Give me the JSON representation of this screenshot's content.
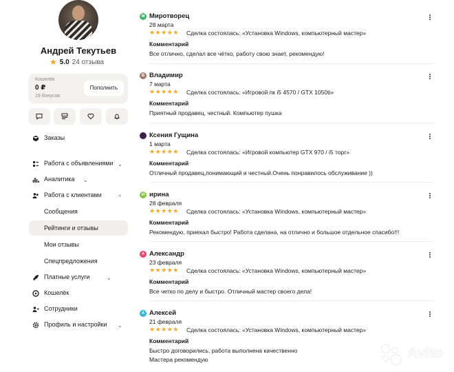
{
  "profile": {
    "name": "Андрей Текутьев",
    "rating": "5.0",
    "reviews_count": "24 отзыва"
  },
  "wallet": {
    "label": "Кошелёк",
    "balance": "0 ₽",
    "bonus": "19 бонусов",
    "topup_label": "Пополнить"
  },
  "quick_actions": [
    {
      "icon": "chat-icon"
    },
    {
      "icon": "list-icon"
    },
    {
      "icon": "heart-icon"
    },
    {
      "icon": "bell-icon"
    }
  ],
  "nav": {
    "orders": "Заказы",
    "ads": "Работа с объявлениями",
    "analytics": "Аналитика",
    "clients": "Работа с клиентами",
    "messages": "Сообщения",
    "ratings": "Рейтинги и отзывы",
    "my_reviews": "Мои отзывы",
    "special": "Спецпредложения",
    "paid": "Платные услуги",
    "wallet": "Кошелёк",
    "staff": "Сотрудники",
    "settings": "Профиль и настройки"
  },
  "reviews": [
    {
      "initial": "М",
      "avatar_color": "#3fb36b",
      "name": "Миротворец",
      "date": "28 марта",
      "stars": 5,
      "deal": "Сделка состоялась: «Установка Windows, компьютерный мастер»",
      "comment_label": "Комментарий",
      "comment": "Все отлично, сделал все чётко, работу свою знает, рекомендую!"
    },
    {
      "initial": "В",
      "avatar_color": "#9a7b6a",
      "name": "Владимир",
      "date": "7 марта",
      "stars": 5,
      "deal": "Сделка состоялась: «Игровой пк i5 4570 / GTX 1050ti»",
      "comment_label": "Комментарий",
      "comment": "Приятный продавец, честный. Компьютер пушка"
    },
    {
      "initial": "",
      "avatar_color": "#3a1f4a",
      "name": "Ксения Гущина",
      "date": "1 марта",
      "stars": 5,
      "deal": "Сделка состоялась: «Игровой компьютер GTX 970 / i5 торг»",
      "comment_label": "Комментарий",
      "comment": "Отличный продавец,понимающий и честный.Очень понравилось обслуживание ))"
    },
    {
      "initial": "И",
      "avatar_color": "#8bc34a",
      "name": "ирина",
      "date": "28 февраля",
      "stars": 5,
      "deal": "Сделка состоялась: «Установка Windows, компьютерный мастер»",
      "comment_label": "Комментарий",
      "comment": "Рекомендую, приехал быстро! Работа сделана, на отлично и большое отдельное спасибо!!!"
    },
    {
      "initial": "А",
      "avatar_color": "#e9466b",
      "name": "Александр",
      "date": "23 февраля",
      "stars": 5,
      "deal": "Сделка состоялась: «Установка Windows, компьютерный мастер»",
      "comment_label": "Комментарий",
      "comment": "Все четко по делу и быстро. Отличный мастер своего дела!"
    },
    {
      "initial": "А",
      "avatar_color": "#36b5d8",
      "name": "Алексей",
      "date": "21 февраля",
      "stars": 5,
      "deal": "Сделка состоялась: «Установка Windows, компьютерный мастер»",
      "comment_label": "Комментарий",
      "comment": "Быстро договорились, работа выполнена качественно",
      "comment2": "Мастера рекомендую"
    }
  ],
  "watermark": "Avito",
  "colors": {
    "star": "#f5a623",
    "active_bg": "#f0efed",
    "wallet_bg": "#f2f1ef"
  }
}
